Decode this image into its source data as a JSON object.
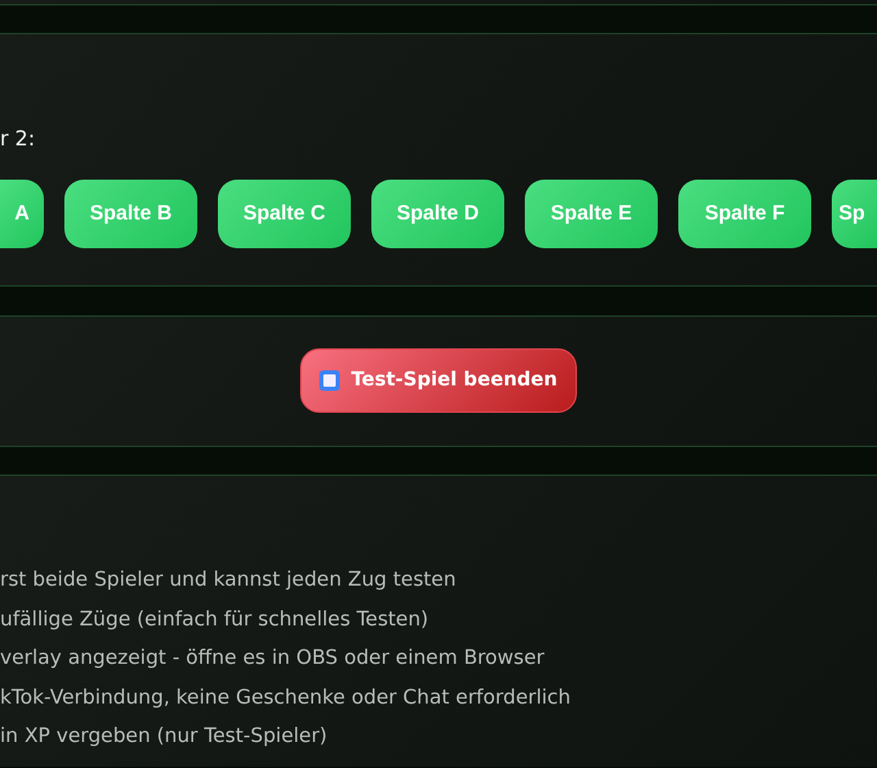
{
  "column_prompt": "r 2:",
  "column_buttons": [
    {
      "label": "A"
    },
    {
      "label": "Spalte B"
    },
    {
      "label": "Spalte C"
    },
    {
      "label": "Spalte D"
    },
    {
      "label": "Spalte E"
    },
    {
      "label": "Spalte F"
    },
    {
      "label": "Sp"
    }
  ],
  "end_button": {
    "label": "Test-Spiel beenden"
  },
  "info_lines": [
    "rst beide Spieler und kannst jeden Zug testen",
    "ufällige Züge (einfach für schnelles Testen)",
    "verlay angezeigt - öffne es in OBS oder einem Browser",
    "kTok-Verbindung, keine Geschenke oder Chat erforderlich",
    "in XP vergeben (nur Test-Spieler)"
  ]
}
